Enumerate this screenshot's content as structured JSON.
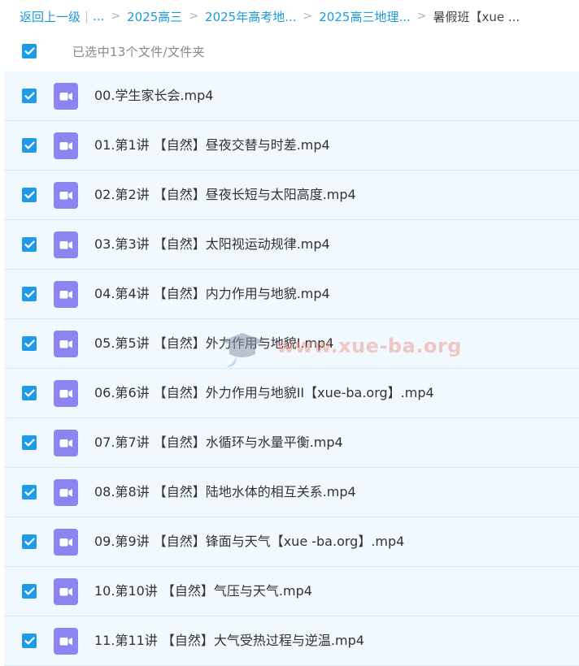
{
  "breadcrumb": {
    "back": "返回上一级",
    "sep": "|",
    "ellipsis": "...",
    "crumbs": [
      "2025高三",
      "2025年高考地...",
      "2025高三地理...",
      "暑假班【xue ..."
    ]
  },
  "selection": {
    "text": "已选中13个文件/文件夹"
  },
  "files": [
    {
      "name": "00.学生家长会.mp4",
      "icon": "video-icon"
    },
    {
      "name": "01.第1讲 【自然】昼夜交替与时差.mp4",
      "icon": "video-icon"
    },
    {
      "name": "02.第2讲 【自然】昼夜长短与太阳高度.mp4",
      "icon": "video-icon"
    },
    {
      "name": "03.第3讲 【自然】太阳视运动规律.mp4",
      "icon": "video-icon"
    },
    {
      "name": "04.第4讲 【自然】内力作用与地貌.mp4",
      "icon": "video-icon"
    },
    {
      "name": "05.第5讲 【自然】外力作用与地貌I.mp4",
      "icon": "video-icon"
    },
    {
      "name": "06.第6讲 【自然】外力作用与地貌II【xue-ba.org】.mp4",
      "icon": "video-icon"
    },
    {
      "name": "07.第7讲 【自然】水循环与水量平衡.mp4",
      "icon": "video-icon"
    },
    {
      "name": "08.第8讲 【自然】陆地水体的相互关系.mp4",
      "icon": "video-icon"
    },
    {
      "name": "09.第9讲 【自然】锋面与天气【xue -ba.org】.mp4",
      "icon": "video-icon"
    },
    {
      "name": "10.第10讲 【自然】气压与天气.mp4",
      "icon": "video-icon"
    },
    {
      "name": "11.第11讲 【自然】大气受热过程与逆温.mp4",
      "icon": "video-icon"
    }
  ],
  "watermark": {
    "text": "www.xue-ba.org"
  },
  "colors": {
    "accent": "#1e9be8",
    "link": "#1a9ae0",
    "icon": "#8c84f0",
    "row_bg": "#f1f9fe"
  }
}
